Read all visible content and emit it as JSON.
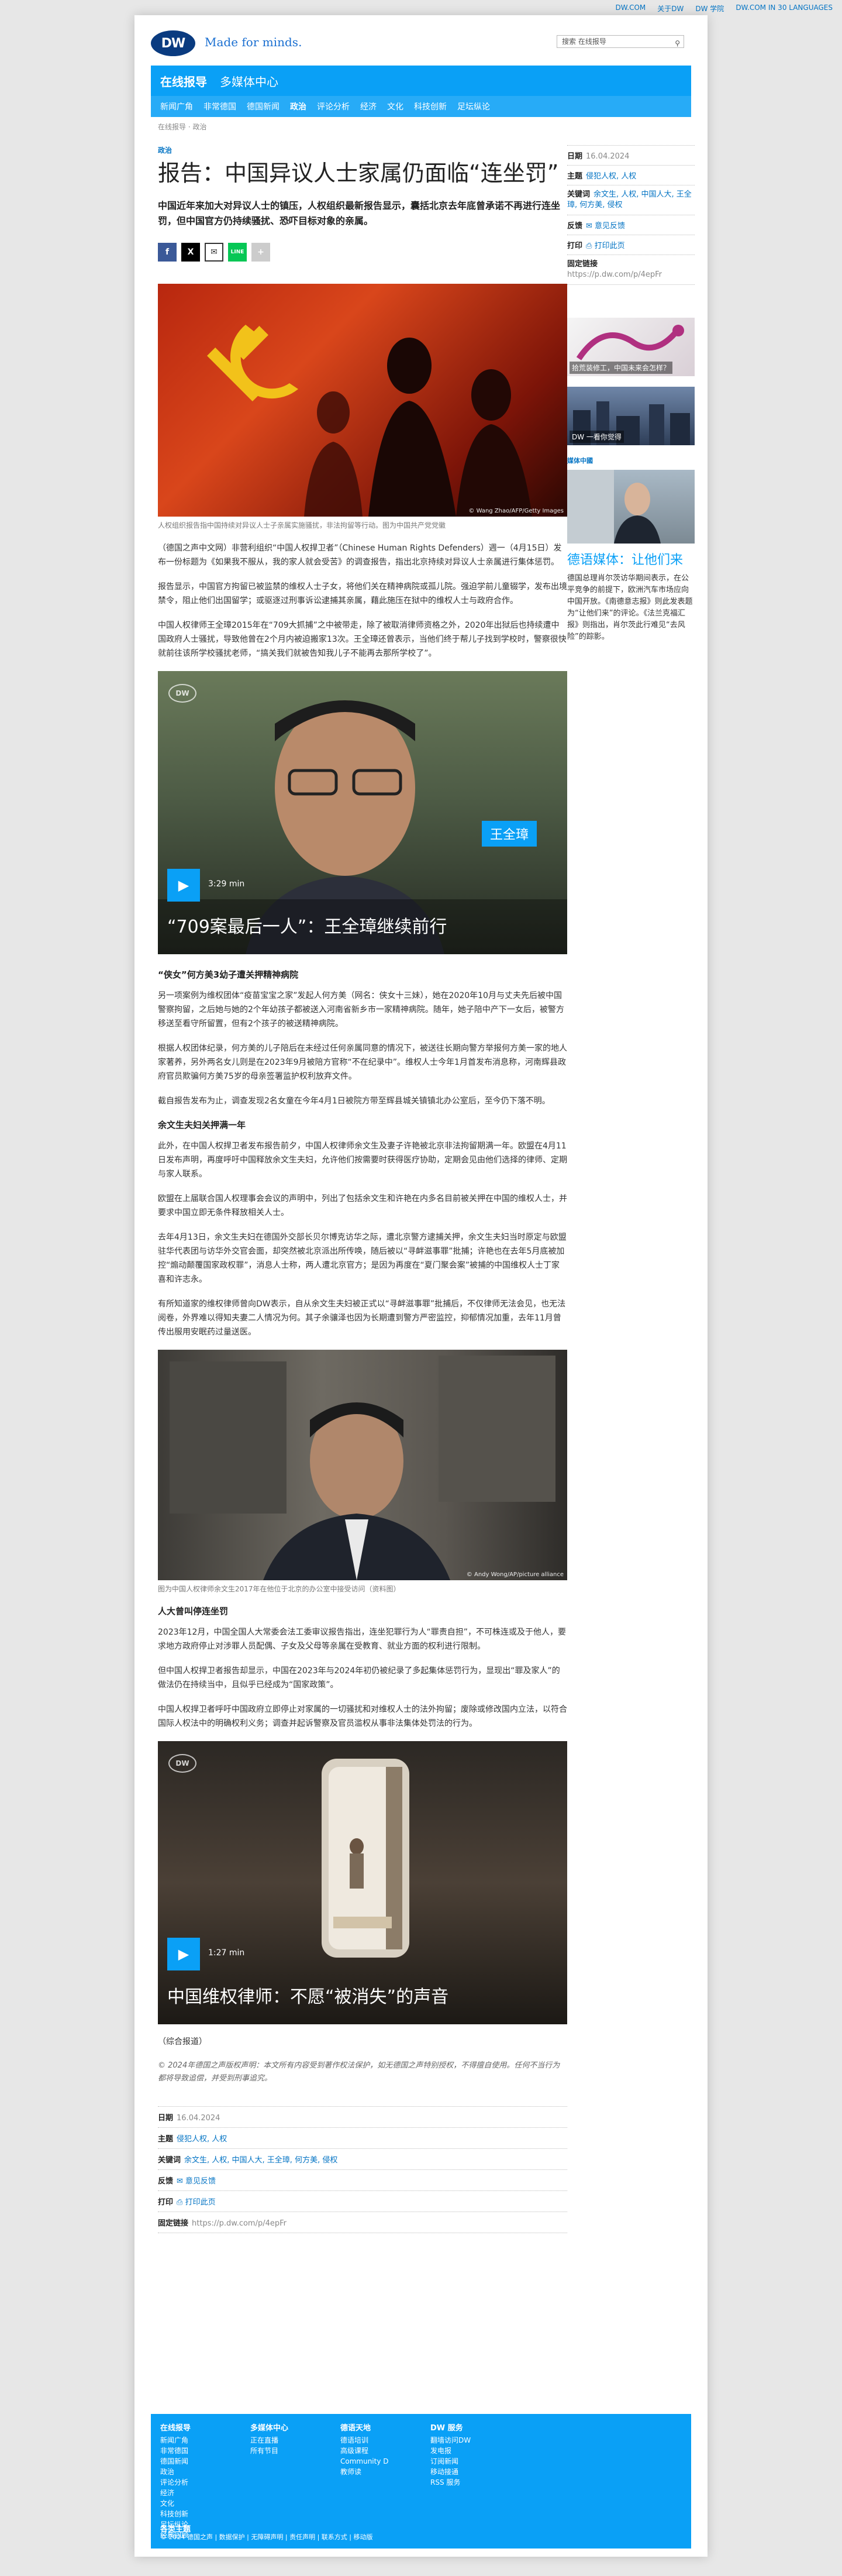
{
  "top_links": [
    "DW.COM",
    "关于DW",
    "DW 学院",
    "DW.COM IN 30 LANGUAGES"
  ],
  "brand": {
    "logo": "DW",
    "tagline": "Made for minds."
  },
  "search": {
    "placeholder": "搜索 在线报导"
  },
  "sections": {
    "primary": "在线报导",
    "secondary": "多媒体中心"
  },
  "nav": [
    "新闻广角",
    "非常德国",
    "德国新闻",
    "政治",
    "评论分析",
    "经济",
    "文化",
    "科技创新",
    "足坛纵论"
  ],
  "breadcrumb": "在线报导 · 政治",
  "article": {
    "kicker": "政治",
    "title": "报告：中国异议人士家属仍面临“连坐罚”",
    "lead": "中国近年来加大对异议人士的镇压，人权组织最新报告显示，囊括北京去年底曾承诺不再进行连坐罚，但中国官方仍持续骚扰、恐吓目标对象的亲属。",
    "share": [
      "f",
      "X",
      "✉",
      "LINE",
      "+"
    ],
    "photo1_caption": "人权组织报告指中国持续对异议人士子亲属实施骚扰，非法拘留等行动。图为中国共产党党徽",
    "photo1_credit": "© Wang Zhao/AFP/Getty Images",
    "paras1": [
      "（德国之声中文网）非营利组织“中国人权捍卫者”（Chinese Human Rights Defenders）週一（4月15日）发布一份标题为《如果我不服从，我的家人就会受苦》的调查报告，指出北京持续对异议人士亲属进行集体惩罚。",
      "报告显示，中国官方拘留已被监禁的维权人士子女，将他们关在精神病院或孤儿院。强迫学前儿童辍学，发布出境禁令，阻止他们出国留学；或驱逐过刑事诉讼逮捕其亲属，藉此施压在狱中的维权人士与政府合作。",
      "中国人权律师王全璋2015年在“709大抓捕”之中被带走，除了被取消律师资格之外，2020年出狱后也持续遭中国政府人士骚扰，导致他曾在2个月内被迫搬家13次。王全璋还曾表示，当他们终于帮儿子找到学校时，警察很快就前往该所学校骚扰老师，“搞关我们就被告知我儿子不能再去那所学校了”。"
    ],
    "video1": {
      "duration": "3:29 min",
      "title": "“709案最后一人”：王全璋继续前行",
      "name_tag": "王全璋"
    },
    "sub1": "“侠女”何方美3幼子遭关押精神病院",
    "paras2": [
      "另一项案例为维权团体“疫苗宝宝之家”发起人何方美（网名：侠女十三妹），她在2020年10月与丈夫先后被中国警察拘留，之后她与她的2个年幼孩子都被送入河南省新乡市一家精神病院。随年，她子陪中产下一女后，被警方移送至看守所留置，但有2个孩子的被送精神病院。",
      "根据人权团体纪录，何方美的儿子陪后在未经过任何亲属同意的情况下，被送往长期向警方举报何方美一家的地人家著养，另外两名女儿则是在2023年9月被陪方官称“不在纪录中”。维权人士今年1月首发布消息称，河南辉县政府官员欺骗何方美75岁的母亲签署监护权利放弃文件。",
      "截自报告发布为止，调查发现2名女童在今年4月1日被院方带至辉县城关镇镇北办公室后，至今仍下落不明。"
    ],
    "sub2": "余文生夫妇关押满一年",
    "paras3": [
      "此外，在中国人权捍卫者发布报告前夕，中国人权律师余文生及妻子许艳被北京非法拘留期满一年。欧盟在4月11日发布声明，再度呼吁中国释放余文生夫妇，允许他们按需要时获得医疗协助，定期会见由他们选择的律师、定期与家人联系。",
      "欧盟在上届联合国人权理事会会议的声明中，列出了包括余文生和许艳在内多名目前被关押在中国的维权人士，并要求中国立即无条件释放相关人士。",
      "去年4月13日，余文生夫妇在德国外交部长贝尔博克访华之际，遭北京警方逮捕关押，余文生夫妇当时原定与欧盟驻华代表团与访华外交官会面，却突然被北京派出所传唤，随后被以“寻衅滋事罪”批捕；许艳也在去年5月底被加控“煽动颠覆国家政权罪”，消息人士称，两人遭北京官方；是因为再度在“夏门聚会案”被捕的中国维权人士丁家喜和许志永。",
      "有所知道家的维权律师曾向DW表示，自从余文生夫妇被正式以“寻衅滋事罪”批捕后，不仅律师无法会见，也无法阅卷，外界难以得知夫妻二人情况为何。其子余骧泽也因为长期遭到警方严密监控，抑郁情况加重，去年11月曾传出服用安眠药过量送医。"
    ],
    "photo2_caption": "图为中国人权律师余文生2017年在他位于北京的办公室中接受访问（资料图）",
    "photo2_credit": "© Andy Wong/AP/picture alliance",
    "sub3": "人大曾叫停连坐罚",
    "paras4": [
      "2023年12月，中国全国人大常委会法工委审议报告指出，连坐犯罪行为人“罪责自担”，不可株连或及于他人，要求地方政府停止对涉罪人员配偶、子女及父母等亲属在受教育、就业方面的权利进行限制。",
      "但中国人权捍卫者报告却显示，中国在2023年与2024年初仍被纪录了多起集体惩罚行为，显现出“罪及家人”的做法仍在持续当中，且似乎已经成为“国家政策”。",
      "中国人权捍卫者呼吁中国政府立即停止对家属的一切骚扰和对维权人士的法外拘留；废除或修改国内立法，以符合国际人权法中的明确权利义务；调查并起诉警察及官员滥权从事非法集体处罚法的行为。"
    ],
    "video2": {
      "duration": "1:27 min",
      "title": "中国维权律师：不愿“被消失”的声音"
    },
    "source": "（综合报道）",
    "copyright": "© 2024年德国之声版权声明：本文所有内容受到著作权法保护，如无德国之声特别授权，不得擅自使用。任何不当行为都将导致追偿，并受到刑事追究。"
  },
  "meta": {
    "date_label": "日期",
    "date": "16.04.2024",
    "topic_label": "主题",
    "topic": "侵犯人权, 人权",
    "keywords_label": "关键词",
    "keywords": "余文生, 人权, 中国人大, 王全璋, 何方美, 侵权",
    "feedback_label": "反馈",
    "feedback": "意见反馈",
    "print_label": "打印",
    "print": "打印此页",
    "link_label": "固定链接",
    "link": "https://p.dw.com/p/4epFr"
  },
  "side": {
    "promo1_caption": "拾荒装修工，中国未来会怎样？",
    "promo2_caption": "DW 一看你觉得",
    "feature_kicker": "媒体中國",
    "feature_title": "德语媒体：让他们来",
    "feature_text": "德国总理肖尔茨访华期间表示，在公平竞争的前提下，欧洲汽车市场应向中国开放。《南德意志报》则此发表题为“让他们来”的评论。《法兰克福汇报》则指出，肖尔茨此行难见“去风险”的踪影。"
  },
  "footer": {
    "col1": {
      "head": "在线报导",
      "items": [
        "新闻广角",
        "非常德国",
        "德国新闻",
        "政治",
        "评论分析",
        "经济",
        "文化",
        "科技创新",
        "足坛纵论",
        "经典回顾"
      ]
    },
    "col2": {
      "head": "多媒体中心",
      "items": [
        "正在直播",
        "所有节目"
      ]
    },
    "col3": {
      "head": "德语天地",
      "items": [
        "德语培训",
        "高级课程",
        "Community D",
        "教师读"
      ]
    },
    "col4": {
      "head": "DW 服务",
      "items": [
        "翻墙访问DW",
        "发电报",
        "订阅新闻",
        "移动接通",
        "RSS 服务"
      ]
    },
    "all_topics": "各类主题",
    "bottom": "© 2024 德国之声 | 数据保护 | 无障碍声明 | 责任声明 | 联系方式 | 移动版"
  },
  "colors": {
    "brand_blue": "#0aa0f6",
    "link_blue": "#0474c4",
    "logo_navy": "#0a3b80"
  }
}
